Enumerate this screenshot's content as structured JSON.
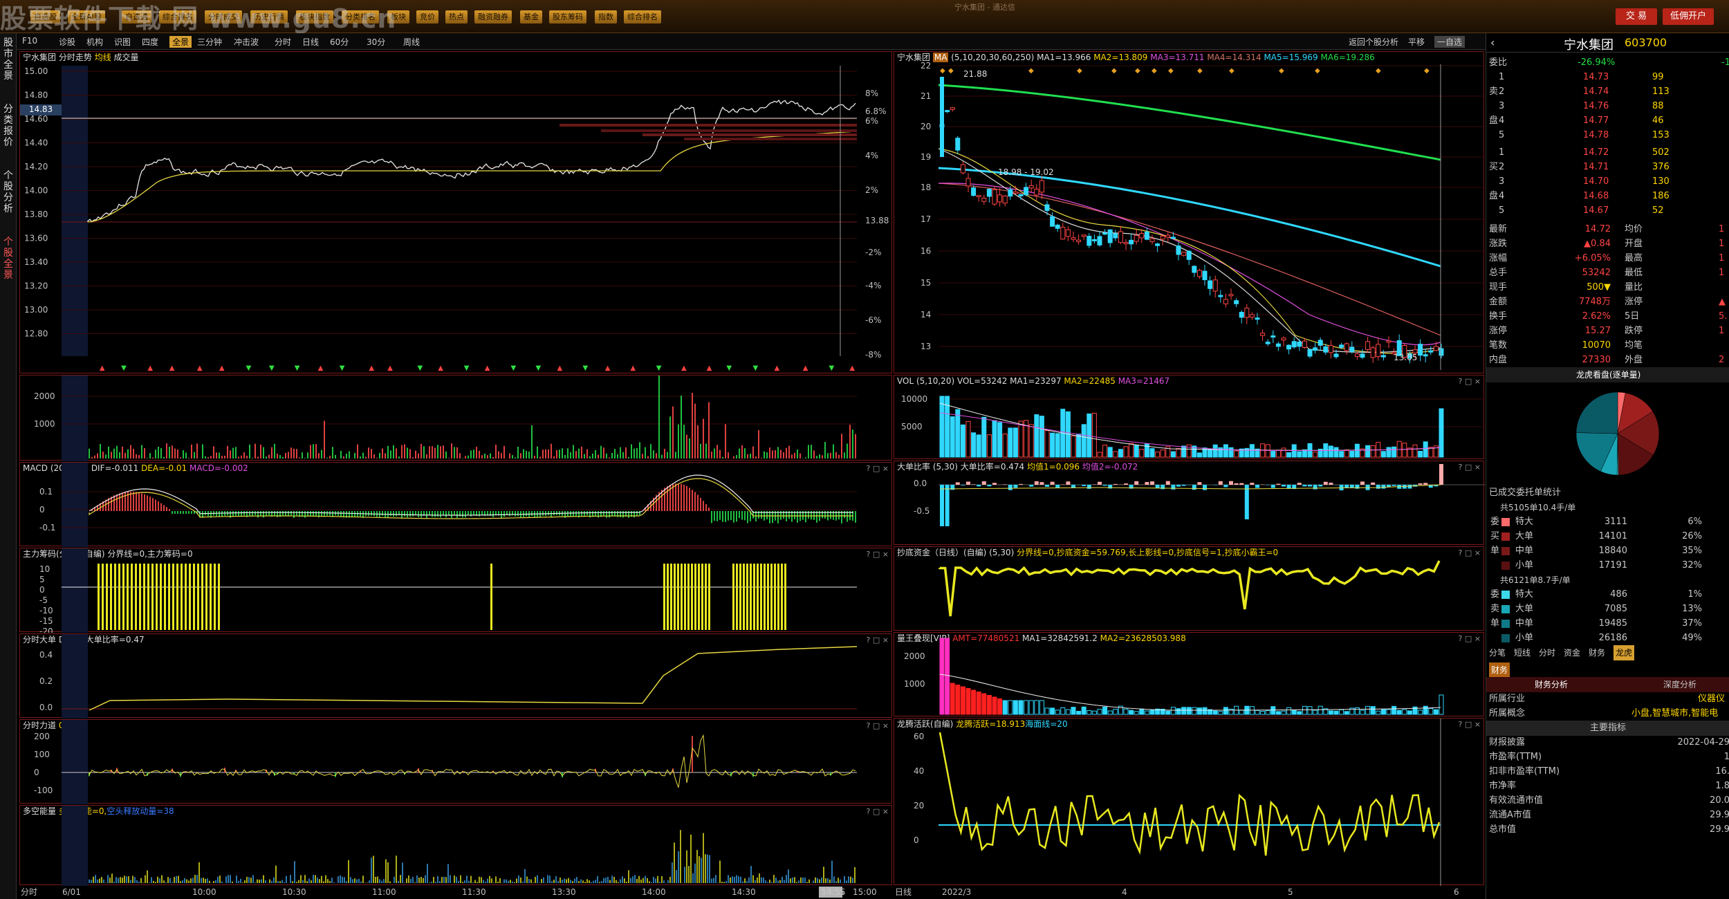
{
  "watermark": "股票软件下载 网 www.gu8.cn",
  "window_title": "宁水集团 - 通达信",
  "menu": [
    "自选股",
    "全景AI股",
    "自选通",
    "综合排名",
    "分时成交",
    "历史行情",
    "板块指数",
    "分类排名",
    "板块",
    "竞价",
    "热点",
    "融资融券",
    "基金",
    "股东筹码",
    "指数",
    "综合排名"
  ],
  "top_buttons": {
    "trade": "交 易",
    "open_account": "低佣开户"
  },
  "left_tabs": [
    "股市全景",
    "分类报价",
    "个股分析",
    "个股全景"
  ],
  "tabs": [
    "F10",
    "诊股",
    "机构",
    "识图",
    "四度",
    "全景",
    "三分钟",
    "冲击波"
  ],
  "subtabs": [
    "分时",
    "日线",
    "60分",
    "30分",
    "周线"
  ],
  "toolbar_right": {
    "back": "返回个股分析",
    "flat": "平移",
    "self": "一自选"
  },
  "intraday": {
    "stock": "宁水集团",
    "mode": "分时走势",
    "series": [
      "均线",
      "成交量"
    ],
    "current_price": "14.83",
    "price_ticks": [
      "15.00",
      "14.80",
      "14.60",
      "14.40",
      "14.20",
      "14.00",
      "13.80",
      "13.60",
      "13.40",
      "13.20",
      "13.00",
      "12.80"
    ],
    "pct_ticks": [
      "8%",
      "6.8%",
      "6%",
      "4%",
      "2%",
      "13.88",
      "-2%",
      "-4%",
      "-6%",
      "-8%"
    ],
    "time_ticks": [
      "分时",
      "6/01",
      "10:00",
      "10:30",
      "11:00",
      "11:30",
      "13:30",
      "14:00",
      "14:30",
      "14:55",
      "15:00"
    ],
    "vol_ticks": [
      "2000",
      "1000"
    ],
    "macd": {
      "name": "MACD",
      "params": "(20,10,7)",
      "dif": "DIF=-0.011",
      "dea": "DEA=-0.01",
      "macd": "MACD=-0.002",
      "ticks": [
        "0.1",
        "0",
        "-0.1"
      ]
    },
    "chips": {
      "name": "主力筹码(分时)",
      "ref": "(自编)",
      "text": "分界线=0,主力筹码=0",
      "ticks": [
        "10",
        "5",
        "0",
        "-5",
        "-10",
        "-15",
        "-20"
      ]
    },
    "bigorder": {
      "name": "分时大单",
      "text": "DX=0,大单比率=0.47",
      "ticks": [
        "0.4",
        "0.2",
        "0.0"
      ]
    },
    "force": {
      "name": "分时力道",
      "text": "0",
      "ticks": [
        "200",
        "100",
        "0",
        "-100"
      ]
    },
    "energy": {
      "name": "多空能量",
      "text": "多头量能=0,",
      "text2": "空头释放动量=38"
    }
  },
  "daily": {
    "stock": "宁水集团",
    "ma_label": "MA",
    "params": "(5,10,20,30,60,250)",
    "ma": [
      "MA1=13.966",
      "MA2=13.809",
      "MA3=13.711",
      "MA4=14.314",
      "MA5=15.969",
      "MA6=19.286"
    ],
    "price_ticks": [
      "22",
      "21",
      "20",
      "19",
      "18",
      "17",
      "16",
      "15",
      "14",
      "13"
    ],
    "high_label": "21.88",
    "mid_label": "18.98 - 19.02",
    "low_label": "13.05",
    "time_ticks": [
      "日线",
      "2022/3",
      "4",
      "5",
      "6"
    ],
    "vol": {
      "name": "VOL",
      "params": "(5,10,20)",
      "text": "VOL=53242",
      "ma": [
        "MA1=23297",
        "MA2=22485",
        "MA3=21467"
      ],
      "ticks": [
        "10000",
        "5000"
      ]
    },
    "bigratio": {
      "name": "大单比率",
      "params": "(5,30)",
      "text": "大单比率=0.474",
      "m1": "均值1=0.096",
      "m2": "均值2=-0.072",
      "ticks": [
        "0.0",
        "-0.5"
      ]
    },
    "bottom": {
      "name": "抄底资金（日线）(自编)",
      "params": "(5,30)",
      "text": "分界线=0,抄底资金=59.769,长上影线=0,抄底信号=1,抄底小霸王=0"
    },
    "lianghuang": {
      "name": "量王叠现[VIP]",
      "amt": "AMT=77480521",
      "ma1": "MA1=32842591.2",
      "ma2": "MA2=23628503.988",
      "ticks": [
        "2000",
        "1000"
      ]
    },
    "dragon": {
      "name": "龙腾活跃(自编)",
      "text": "龙腾活跃=18.913",
      "sea": "海面线=20",
      "ticks": [
        "60",
        "40",
        "20",
        "0"
      ]
    }
  },
  "quote": {
    "name": "宁水集团",
    "code": "603700",
    "weibi_label": "委比",
    "weibi": "-26.94%",
    "weicha": "-1",
    "sells": [
      {
        "lv": "5",
        "p": "14.78",
        "v": "153"
      },
      {
        "lv": "4",
        "p": "14.77",
        "v": "46"
      },
      {
        "lv": "3",
        "p": "14.76",
        "v": "88"
      },
      {
        "lv": "2",
        "p": "14.74",
        "v": "113"
      },
      {
        "lv": "1",
        "p": "14.73",
        "v": "99"
      }
    ],
    "buys": [
      {
        "lv": "1",
        "p": "14.72",
        "v": "502"
      },
      {
        "lv": "2",
        "p": "14.71",
        "v": "376"
      },
      {
        "lv": "3",
        "p": "14.70",
        "v": "130"
      },
      {
        "lv": "4",
        "p": "14.68",
        "v": "186"
      },
      {
        "lv": "5",
        "p": "14.67",
        "v": "52"
      }
    ],
    "sell_side": [
      "卖",
      "盘"
    ],
    "buy_side": [
      "买",
      "盘"
    ],
    "stats": [
      [
        "最新",
        "14.72",
        "均价",
        "1"
      ],
      [
        "涨跌",
        "▲0.84",
        "开盘",
        "1"
      ],
      [
        "涨幅",
        "+6.05%",
        "最高",
        "1"
      ],
      [
        "总手",
        "53242",
        "最低",
        "1"
      ],
      [
        "现手",
        "500▼",
        "量比",
        ""
      ],
      [
        "金额",
        "7748万",
        "涨停",
        "▲"
      ],
      [
        "换手",
        "2.62%",
        "5日",
        "5."
      ],
      [
        "涨停",
        "15.27",
        "跌停",
        "1"
      ],
      [
        "笔数",
        "10070",
        "均笔",
        ""
      ],
      [
        "内盘",
        "27330",
        "外盘",
        "2"
      ]
    ],
    "dragon_title": "龙虎看盘(逐单量)",
    "pie": [
      {
        "v": 6,
        "c": "#ff6a6a"
      },
      {
        "v": 26,
        "c": "#a02020"
      },
      {
        "v": 35,
        "c": "#7a1818"
      },
      {
        "v": 32,
        "c": "#5a1010"
      },
      {
        "v": 1,
        "c": "#3ad8e8"
      },
      {
        "v": 13,
        "c": "#1aa8b8"
      },
      {
        "v": 37,
        "c": "#0e7a88"
      },
      {
        "v": 49,
        "c": "#0a5a66"
      }
    ],
    "deal_title": "已成交委托单统计",
    "buy_total": "共5105单10.4手/单",
    "buy_rows": [
      [
        "特大",
        "3111",
        "6%"
      ],
      [
        "大单",
        "14101",
        "26%"
      ],
      [
        "中单",
        "18840",
        "35%"
      ],
      [
        "小单",
        "17191",
        "32%"
      ]
    ],
    "buy_side_label": [
      "委",
      "买",
      "单"
    ],
    "sell_total": "共6121单8.7手/单",
    "sell_rows": [
      [
        "特大",
        "486",
        "1%"
      ],
      [
        "大单",
        "7085",
        "13%"
      ],
      [
        "中单",
        "19485",
        "37%"
      ],
      [
        "小单",
        "26186",
        "49%"
      ]
    ],
    "sell_side_label": [
      "委",
      "卖",
      "单"
    ],
    "bottom_tabs": [
      "分笔",
      "短线",
      "分时",
      "资金",
      "财务",
      "龙虎"
    ],
    "fin_tab": "财务",
    "fin_tabs": [
      "财务分析",
      "深度分析"
    ],
    "industry_label": "所属行业",
    "industry": "仪器仪",
    "concept_label": "所属概念",
    "concept": "小盘,智慧城市,智能电",
    "main_index": "主要指标",
    "fin_rows": [
      [
        "财报披露",
        "2022-04-29"
      ],
      [
        "市盈率(TTM)",
        "1"
      ],
      [
        "扣非市盈率(TTM)",
        "16."
      ],
      [
        "市净率",
        "1.8"
      ],
      [
        "有效流通市值",
        "20.0"
      ],
      [
        "流通A市值",
        "29.9"
      ],
      [
        "总市值",
        "29.9"
      ]
    ]
  }
}
